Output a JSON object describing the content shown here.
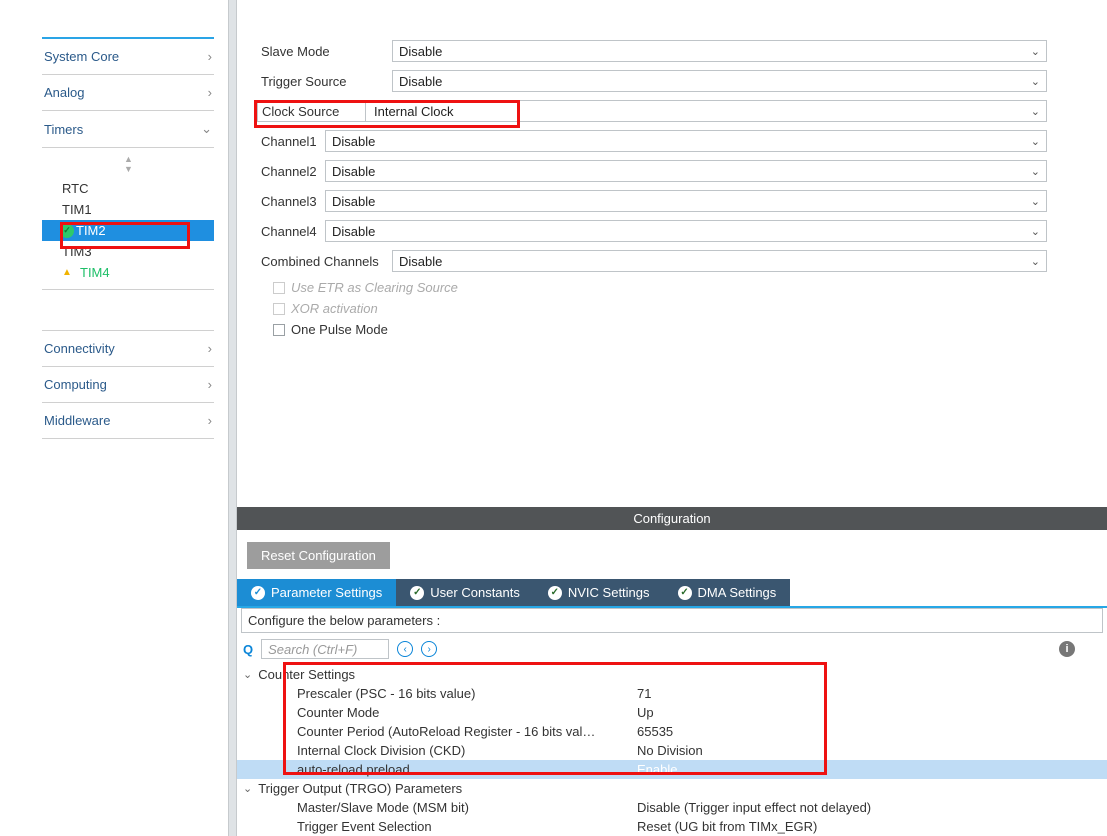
{
  "sidebar": {
    "categories": {
      "system_core": {
        "label": "System Core"
      },
      "analog": {
        "label": "Analog"
      },
      "timers": {
        "label": "Timers"
      },
      "connectivity": {
        "label": "Connectivity"
      },
      "computing": {
        "label": "Computing"
      },
      "middleware": {
        "label": "Middleware"
      }
    },
    "timers_items": {
      "rtc": {
        "label": "RTC"
      },
      "tim1": {
        "label": "TIM1"
      },
      "tim2": {
        "label": "TIM2"
      },
      "tim3": {
        "label": "TIM3"
      },
      "tim4": {
        "label": "TIM4"
      }
    }
  },
  "form": {
    "slave_mode": {
      "label": "Slave Mode",
      "value": "Disable"
    },
    "trigger_source": {
      "label": "Trigger Source",
      "value": "Disable"
    },
    "clock_source": {
      "label": "Clock Source",
      "value": "Internal Clock"
    },
    "channel1": {
      "label": "Channel1",
      "value": "Disable"
    },
    "channel2": {
      "label": "Channel2",
      "value": "Disable"
    },
    "channel3": {
      "label": "Channel3",
      "value": "Disable"
    },
    "channel4": {
      "label": "Channel4",
      "value": "Disable"
    },
    "combined": {
      "label": "Combined Channels",
      "value": "Disable"
    },
    "use_etr": {
      "label": "Use ETR as Clearing Source"
    },
    "xor": {
      "label": "XOR activation"
    },
    "one_pulse": {
      "label": "One Pulse Mode"
    }
  },
  "config_header": "Configuration",
  "reset_btn": "Reset Configuration",
  "tabs": {
    "param": "Parameter Settings",
    "user": "User Constants",
    "nvic": "NVIC Settings",
    "dma": "DMA Settings"
  },
  "config_desc": "Configure the below parameters :",
  "search": {
    "placeholder": "Search (Ctrl+F)"
  },
  "groups": {
    "counter": {
      "label": "Counter Settings"
    },
    "trgo": {
      "label": "Trigger Output (TRGO) Parameters"
    }
  },
  "params": {
    "prescaler": {
      "name": "Prescaler (PSC - 16 bits value)",
      "value": "71"
    },
    "counter_mode": {
      "name": "Counter Mode",
      "value": "Up"
    },
    "counter_period": {
      "name": "Counter Period (AutoReload Register - 16 bits val…",
      "value": "65535"
    },
    "ckd": {
      "name": "Internal Clock Division (CKD)",
      "value": "No Division"
    },
    "arpe": {
      "name": "auto-reload preload",
      "value": "Enable"
    },
    "msm": {
      "name": "Master/Slave Mode (MSM bit)",
      "value": "Disable (Trigger input effect not delayed)"
    },
    "trg_evt": {
      "name": "Trigger Event Selection",
      "value": "Reset (UG bit from TIMx_EGR)"
    }
  }
}
